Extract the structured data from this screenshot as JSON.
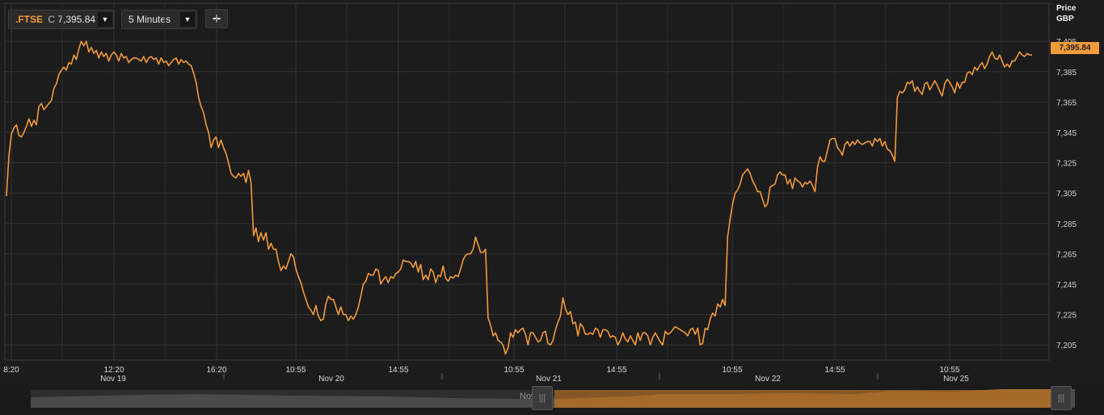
{
  "toolbar": {
    "symbol": ".FTSE",
    "close_flag": "C",
    "close_value": "7,395.84",
    "interval": "5 Minutes",
    "add_label": "+",
    "dropdown_glyph": "▼"
  },
  "axis": {
    "title_line1": "Price",
    "title_line2": "GBP",
    "last_price_badge": "7,395.84"
  },
  "navigator": {
    "label": "Nov 19",
    "grip_glyph": "|||"
  },
  "colors": {
    "line": "#f39a3b",
    "background": "#1c1c1c",
    "grid": "#343434",
    "navigator_selection": "#8a5a24"
  },
  "chart_data": {
    "type": "line",
    "series": [
      {
        "x": [
          0,
          1,
          2,
          3,
          4,
          5,
          6,
          7,
          8,
          9,
          10,
          11,
          12,
          13,
          14,
          15,
          16,
          17,
          18,
          19,
          20,
          21,
          22,
          23,
          24,
          25,
          26,
          27,
          28,
          29,
          30,
          31,
          32,
          33,
          34,
          35,
          36,
          37,
          38,
          39,
          40,
          41,
          42,
          43,
          44,
          45,
          46,
          47,
          48,
          49,
          50,
          51,
          52,
          53,
          54,
          55,
          56,
          57,
          58,
          59,
          60,
          61,
          62,
          63,
          64,
          65,
          66,
          67,
          68,
          69,
          70,
          71,
          72,
          73,
          74,
          75,
          76,
          77,
          78,
          79,
          80,
          81,
          82,
          83,
          84,
          85,
          86,
          87,
          88,
          89,
          90,
          91,
          92,
          93,
          94,
          95,
          96,
          97,
          98,
          99,
          100,
          101,
          102,
          103,
          104,
          105,
          106,
          107,
          108,
          109,
          110,
          111,
          112,
          113,
          114,
          115,
          116,
          117,
          118,
          119,
          120,
          121,
          122,
          123,
          124,
          125,
          126,
          127,
          128,
          129,
          130,
          131,
          132,
          133,
          134,
          135,
          136,
          137,
          138,
          139,
          140,
          141,
          142,
          143,
          144,
          145,
          146,
          147,
          148,
          149,
          150,
          151,
          152,
          153,
          154,
          155,
          156,
          157,
          158,
          159,
          160,
          161,
          162,
          163,
          164,
          165,
          166,
          167,
          168,
          169,
          170,
          171,
          172,
          173,
          174,
          175,
          176,
          177,
          178,
          179,
          180,
          181,
          182,
          183,
          184,
          185,
          186,
          187,
          188,
          189,
          190,
          191,
          192,
          193,
          194,
          195,
          196,
          197,
          198,
          199,
          200,
          201,
          202,
          203,
          204,
          205,
          206,
          207,
          208,
          209,
          210,
          211,
          212,
          213,
          214,
          215,
          216,
          217,
          218,
          219,
          220,
          221,
          222,
          223,
          224,
          225,
          226,
          227,
          228,
          229,
          230,
          231,
          232,
          233,
          234,
          235,
          236,
          237,
          238,
          239,
          240,
          241,
          242,
          243,
          244,
          245,
          246,
          247,
          248,
          249,
          250,
          251,
          252,
          253,
          254,
          255,
          256,
          257,
          258,
          259,
          260,
          261,
          262,
          263,
          264,
          265,
          266,
          267,
          268,
          269,
          270,
          271,
          272,
          273,
          274,
          275,
          276,
          277,
          278,
          279,
          280,
          281,
          282,
          283,
          284,
          285,
          286,
          287,
          288,
          289,
          290,
          291,
          292,
          293,
          294,
          295,
          296,
          297,
          298,
          299,
          300,
          301,
          302,
          303,
          304,
          305,
          306,
          307,
          308,
          309,
          310,
          311,
          312,
          313,
          314,
          315,
          316,
          317,
          318
        ],
        "values": [
          7303,
          7330,
          7344,
          7348,
          7350,
          7343,
          7342,
          7345,
          7349,
          7354,
          7349,
          7353,
          7350,
          7362,
          7364,
          7360,
          7362,
          7364,
          7366,
          7374,
          7377,
          7383,
          7386,
          7388,
          7386,
          7391,
          7390,
          7396,
          7393,
          7400,
          7405,
          7402,
          7405,
          7398,
          7401,
          7397,
          7399,
          7394,
          7398,
          7395,
          7397,
          7392,
          7396,
          7398,
          7396,
          7392,
          7397,
          7394,
          7395,
          7391,
          7393,
          7394,
          7394,
          7393,
          7392,
          7395,
          7391,
          7394,
          7395,
          7393,
          7394,
          7390,
          7394,
          7391,
          7392,
          7389,
          7391,
          7393,
          7394,
          7390,
          7393,
          7391,
          7392,
          7390,
          7389,
          7384,
          7378,
          7368,
          7362,
          7358,
          7350,
          7345,
          7335,
          7340,
          7342,
          7335,
          7340,
          7335,
          7331,
          7325,
          7318,
          7316,
          7315,
          7318,
          7316,
          7318,
          7312,
          7320,
          7312,
          7277,
          7282,
          7273,
          7279,
          7274,
          7279,
          7268,
          7272,
          7268,
          7268,
          7260,
          7254,
          7257,
          7255,
          7260,
          7265,
          7263,
          7255,
          7250,
          7246,
          7240,
          7235,
          7230,
          7228,
          7225,
          7231,
          7224,
          7221,
          7222,
          7232,
          7237,
          7235,
          7235,
          7230,
          7225,
          7230,
          7225,
          7225,
          7221,
          7224,
          7222,
          7225,
          7230,
          7237,
          7245,
          7247,
          7252,
          7251,
          7251,
          7255,
          7254,
          7245,
          7248,
          7250,
          7246,
          7250,
          7249,
          7252,
          7253,
          7255,
          7261,
          7260,
          7260,
          7259,
          7256,
          7260,
          7253,
          7258,
          7248,
          7251,
          7248,
          7255,
          7253,
          7246,
          7251,
          7250,
          7257,
          7249,
          7247,
          7250,
          7249,
          7251,
          7250,
          7255,
          7261,
          7264,
          7265,
          7265,
          7268,
          7276,
          7271,
          7266,
          7266,
          7268,
          7223,
          7218,
          7211,
          7213,
          7208,
          7207,
          7205,
          7199,
          7203,
          7213,
          7210,
          7215,
          7213,
          7215,
          7216,
          7212,
          7205,
          7213,
          7213,
          7210,
          7207,
          7208,
          7213,
          7214,
          7206,
          7205,
          7208,
          7215,
          7220,
          7224,
          7236,
          7229,
          7225,
          7227,
          7219,
          7220,
          7211,
          7219,
          7217,
          7212,
          7212,
          7213,
          7212,
          7216,
          7215,
          7210,
          7215,
          7215,
          7214,
          7210,
          7211,
          7210,
          7205,
          7208,
          7213,
          7209,
          7207,
          7211,
          7208,
          7205,
          7213,
          7208,
          7213,
          7213,
          7211,
          7205,
          7210,
          7213,
          7210,
          7207,
          7205,
          7214,
          7212,
          7213,
          7215,
          7217,
          7216,
          7215,
          7214,
          7213,
          7211,
          7215,
          7216,
          7212,
          7216,
          7205,
          7206,
          7216,
          7215,
          7222,
          7226,
          7224,
          7232,
          7230,
          7235,
          7231,
          7276,
          7288,
          7298,
          7305,
          7307,
          7311,
          7317,
          7319,
          7321,
          7318,
          7313,
          7310,
          7306,
          7306,
          7301,
          7296,
          7298,
          7309,
          7310,
          7311,
          7317,
          7319,
          7317,
          7317,
          7311,
          7314,
          7308,
          7315,
          7313,
          7312
        ],
        "note_end_segment_values": [
          7309,
          7312,
          7311,
          7313,
          7310,
          7306,
          7322,
          7329,
          7326,
          7326,
          7333,
          7340,
          7341,
          7341,
          7335,
          7333,
          7330,
          7337,
          7339,
          7336,
          7339,
          7337,
          7340,
          7338,
          7337,
          7338,
          7339,
          7339,
          7336,
          7341,
          7339,
          7341,
          7336,
          7339,
          7334,
          7333,
          7330,
          7326,
          7368,
          7372,
          7371,
          7373,
          7378,
          7377,
          7379,
          7372,
          7375,
          7372,
          7370,
          7377,
          7378,
          7373,
          7376,
          7379,
          7376,
          7372,
          7369,
          7377,
          7380,
          7378,
          7375,
          7371,
          7378,
          7374,
          7378,
          7378,
          7384,
          7385,
          7383,
          7388,
          7386,
          7389,
          7391,
          7387,
          7390,
          7395,
          7398,
          7394,
          7393,
          7396,
          7392,
          7388,
          7390,
          7388,
          7392,
          7392,
          7395,
          7398,
          7396,
          7395,
          7397,
          7396,
          7396
        ]
      }
    ],
    "x_tick_labels": [
      "8:20",
      "12:20",
      "16:20",
      "10:55",
      "14:55",
      "10:55",
      "14:55",
      "10:55",
      "14:55",
      "10:55"
    ],
    "date_labels": [
      "Nov 19",
      "Nov 20",
      "Nov 21",
      "Nov 22",
      "Nov 25"
    ],
    "y_ticks": [
      7205,
      7225,
      7245,
      7265,
      7285,
      7305,
      7325,
      7345,
      7365,
      7385,
      7405
    ],
    "y_tick_labels": [
      "7,205",
      "7,225",
      "7,245",
      "7,265",
      "7,285",
      "7,305",
      "7,325",
      "7,345",
      "7,365",
      "7,385",
      "7,405"
    ],
    "ylim": [
      7195,
      7412
    ],
    "ylabel": "Price GBP",
    "grid": true,
    "last_value": 7395.84
  }
}
